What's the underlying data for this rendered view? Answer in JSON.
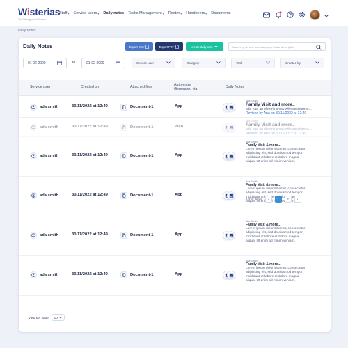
{
  "brand": {
    "name_part1": "W",
    "name_i": "i",
    "name_part2": "sterias",
    "tagline": "The Management System"
  },
  "nav": [
    {
      "label": "Staff",
      "caret": true,
      "active": false
    },
    {
      "label": "Service users",
      "caret": true,
      "active": false
    },
    {
      "label": "Daily notes",
      "caret": false,
      "active": true
    },
    {
      "label": "Tasks Management",
      "caret": true,
      "active": false
    },
    {
      "label": "Roster",
      "caret": true,
      "active": false
    },
    {
      "label": "Handovers",
      "caret": true,
      "active": false
    },
    {
      "label": "Documents",
      "caret": false,
      "active": false
    }
  ],
  "breadcrumb": "Daily Notes",
  "page_title": "Daily Notes",
  "toolbar": {
    "export_csv": "Export CSV",
    "export_pdf": "Export PDF",
    "create_note": "create daily note",
    "search_placeholder": "Search by service user/category/ tasks/ description"
  },
  "filters": {
    "date_from": "01-02-2000",
    "to_label": "to",
    "date_to": "01-02-2000",
    "service_user": "Service user",
    "category": "Category",
    "task": "Task",
    "created_by": "Created by"
  },
  "columns": {
    "service_user": "Service user",
    "created_on": "Created on",
    "attached_files": "Attached files",
    "auto_entry_1": "Auto entry",
    "auto_entry_2": "Generated via",
    "daily_notes": "Daily Notes"
  },
  "rows": [
    {
      "user": "ada smith",
      "created": "30/11/2022 at 12:49",
      "file": "Document-1",
      "via": "App",
      "author": "Ana Smith",
      "note_title": "Family Visit and more..",
      "note_body": "ada had an electric shaw with assistance...",
      "revised": "Revised by Ana on 30/11/2022 at 12:49",
      "faded": false,
      "variant": "first"
    },
    {
      "user": "ada smith",
      "created": "30/11/2022 at 12:49",
      "file": "Document-1",
      "via": "Web",
      "author": "Ana Smith",
      "note_title": "Family Visit and more..",
      "note_body": "ada had an electric shaw with assistance...",
      "revised": "Revised by Ana on 30/11/2022 at 12:49",
      "faded": true,
      "variant": "first"
    },
    {
      "user": "ada smith",
      "created": "30/11/2022 at 12:49",
      "file": "Document-1",
      "via": "App",
      "author": "Ana Smith",
      "note_title": "Family Visit & more...",
      "note_body_lines": [
        "Lorem ipsum dolor sit amet, consectetur",
        "adipiscing elit, sed do eiusmod tempor",
        "incididunt ut labore et dolore magna",
        "aliqua. Ut enim ad minim veniam,"
      ],
      "faded": false,
      "variant": "lorem"
    },
    {
      "user": "ada smith",
      "created": "30/11/2022 at 12:49",
      "file": "Document-1",
      "via": "App",
      "author": "Ana Smith",
      "note_title": "Family Visit & more...",
      "note_body_lines": [
        "Lorem ipsum dolor sit amet, consectetur",
        "adipiscing elit, sed do eiusmod tempor",
        "incididunt ut labore et dolore magna",
        "aliqua. Ut enim ad minim veniam,"
      ],
      "faded": false,
      "variant": "lorem"
    },
    {
      "user": "ada smith",
      "created": "30/11/2022 at 12:49",
      "file": "Document-1",
      "via": "App",
      "author": "Ana Smith",
      "note_title": "Family Visit & more...",
      "note_body_lines": [
        "Lorem ipsum dolor sit amet, consectetur",
        "adipiscing elit, sed do eiusmod tempor",
        "incididunt ut labore et dolore magna",
        "aliqua. Ut enim ad minim veniam,"
      ],
      "faded": false,
      "variant": "lorem"
    },
    {
      "user": "ada smith",
      "created": "30/11/2022 at 12:49",
      "file": "Document-1",
      "via": "App",
      "author": "Ana Smith",
      "note_title": "Family Visit & more...",
      "note_body_lines": [
        "Lorem ipsum dolor sit amet, consectetur",
        "adipiscing elit, sed do eiusmod tempor",
        "incididunt ut labore et dolore magna",
        "aliqua. Ut enim ad minim veniam,"
      ],
      "faded": false,
      "variant": "lorem"
    }
  ],
  "pagination": {
    "summary": "1-2 of items",
    "prev": "‹",
    "current_page": "1",
    "next_page": "2",
    "next": "›"
  },
  "footer": {
    "per_page_label": "View per page",
    "per_page_value": "10"
  },
  "colors": {
    "accent": "#19c2a1",
    "primary": "#22386e",
    "link": "#2f6fd6"
  }
}
